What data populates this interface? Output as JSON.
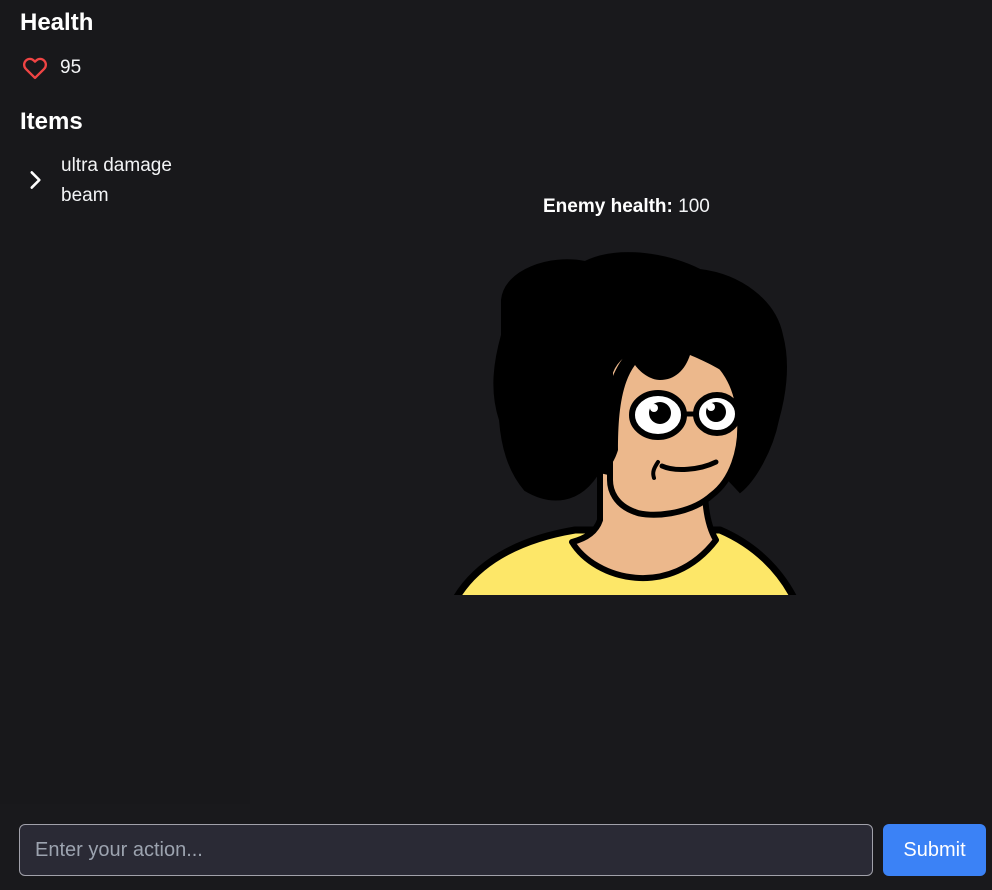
{
  "sidebar": {
    "health": {
      "title": "Health",
      "icon": "heart-icon",
      "icon_color": "#ef4444",
      "value": "95"
    },
    "items": {
      "title": "Items",
      "list": [
        {
          "label": "ultra damage beam",
          "icon": "chevron-right-icon"
        }
      ]
    }
  },
  "enemy": {
    "health_label": "Enemy health:",
    "health_value": "100",
    "character": "cartoon-enemy-character"
  },
  "action_bar": {
    "input_value": "",
    "input_placeholder": "Enter your action...",
    "submit_label": "Submit",
    "submit_color": "#3b82f6"
  }
}
